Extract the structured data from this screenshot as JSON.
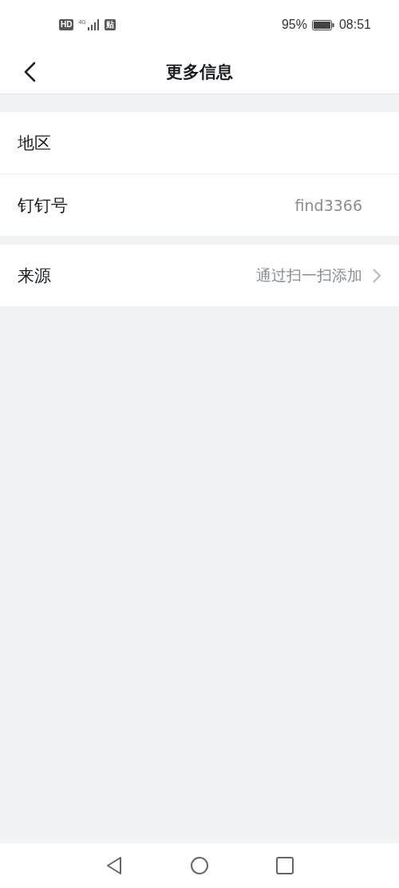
{
  "status_bar": {
    "badges": [
      "HD",
      "贴"
    ],
    "network": "4G",
    "battery": "95%",
    "time": "08:51"
  },
  "header": {
    "title": "更多信息"
  },
  "sections": [
    {
      "rows": [
        {
          "label": "地区",
          "chevron": false
        },
        {
          "label": "钉钉号",
          "value": "find3366",
          "chevron": false
        }
      ]
    },
    {
      "rows": [
        {
          "label": "来源",
          "value": "通过扫一扫添加",
          "chevron": true
        }
      ]
    }
  ]
}
